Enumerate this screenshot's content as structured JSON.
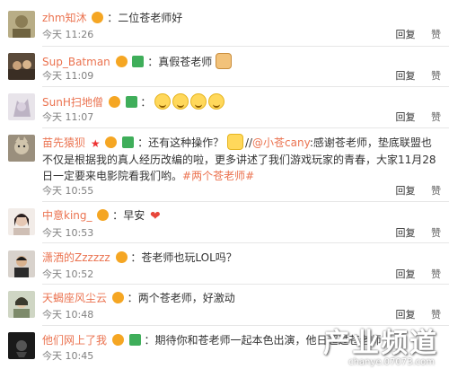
{
  "comments": [
    {
      "user": "zhm知沐",
      "text": "二位苍老师好",
      "time": "今天 11:26",
      "reply": "回复",
      "like": "赞"
    },
    {
      "user": "Sup_Batman",
      "text": "真假苍老师",
      "time": "今天 11:09",
      "reply": "回复",
      "like": "赞"
    },
    {
      "user": "SunH扫地僧",
      "text": "",
      "time": "今天 11:07",
      "reply": "回复",
      "like": "赞"
    },
    {
      "user": "苗先猿狈",
      "text_a": "还有这种操作？",
      "text_b": "//",
      "mention": "@小苍cany",
      "text_c": ":感谢苍老师，垫底联盟也不仅是根据我的真人经历改编的啦，更多讲述了我们游戏玩家的青春，大家11月28日一定要来电影院看我们哟。",
      "topic": "#两个苍老师#",
      "time": "今天 10:55",
      "reply": "回复",
      "like": "赞"
    },
    {
      "user": "中意king_",
      "text": "早安",
      "time": "今天 10:53",
      "reply": "回复",
      "like": "赞"
    },
    {
      "user": "潇洒的Zzzzzz",
      "text": "苍老师也玩LOL吗？",
      "time": "今天 10:52",
      "reply": "回复",
      "like": "赞"
    },
    {
      "user": "天蝎座风尘云",
      "text": "两个苍老师，好激动",
      "time": "今天 10:48",
      "reply": "回复",
      "like": "赞"
    },
    {
      "user": "他们网上了我",
      "text": "期待你和苍老师一起本色出演，他日超过苍老师",
      "time": "今天 10:45",
      "reply": "回复",
      "like": "赞"
    }
  ],
  "watermark": {
    "title": "产业频道",
    "url": "chanye.07073.com"
  },
  "colors": {
    "username": "#eb7350",
    "text": "#333333",
    "time": "#808080",
    "divider": "#e6e6e6"
  }
}
